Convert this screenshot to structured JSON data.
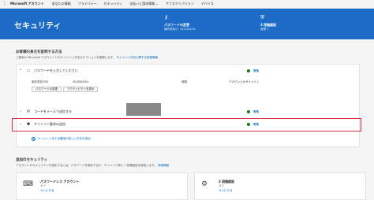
{
  "topnav": {
    "brand": "Microsoft アカウント",
    "items": [
      "あなたの情報",
      "プライバシー",
      "セキュリティ",
      "支払いと請求情報 ⌄",
      "サブスクリプション",
      "デバイス"
    ]
  },
  "hero": {
    "title": "セキュリティ",
    "quick_actions": [
      {
        "title": "パスワードの変更",
        "sub": "最終更新日: 2024/05/01"
      },
      {
        "title": "2 段階認証",
        "sub": "管理 >"
      }
    ]
  },
  "section1": {
    "title": "お客様の身元を証明する方法",
    "desc": "ご使用の Microsoft アカウントへのサインイン方法のオプションを管理します。",
    "desc_link": "サインイン方法に関する詳細情報"
  },
  "methods": [
    {
      "label": "パスワードを入力してください",
      "status": "有効"
    },
    {
      "label": "コードをメールで送信する",
      "status": "有効"
    },
    {
      "label": "サインイン要求の送信",
      "status": "有効"
    }
  ],
  "detail": {
    "updated_label": "最終更新日時",
    "updated_value": "2025/05/01",
    "type_label": "種類",
    "type_value": "アカウントのサインイン",
    "change_btn": "パスワードの変更",
    "toggle_btn": "アクティビティを表示"
  },
  "add_method": "サインインまたは確認の新しい方法を追加",
  "section2": {
    "title": "追加のセキュリティ",
    "desc": "アカウントのセキュリティを強化するには、パスワードを削除するか、サインイン時に 2 段階認証を使用します。",
    "desc_link": "詳細情報"
  },
  "cards": [
    {
      "title": "パスワードレス アカウント",
      "state": "オフ",
      "link": "オンにする"
    },
    {
      "title": "2 段階認証",
      "state": "オフ",
      "link": "オンにする"
    }
  ],
  "colors": {
    "brand_blue": "#1c6bc7",
    "status_green": "#107c10",
    "highlight_red": "#d13438"
  }
}
